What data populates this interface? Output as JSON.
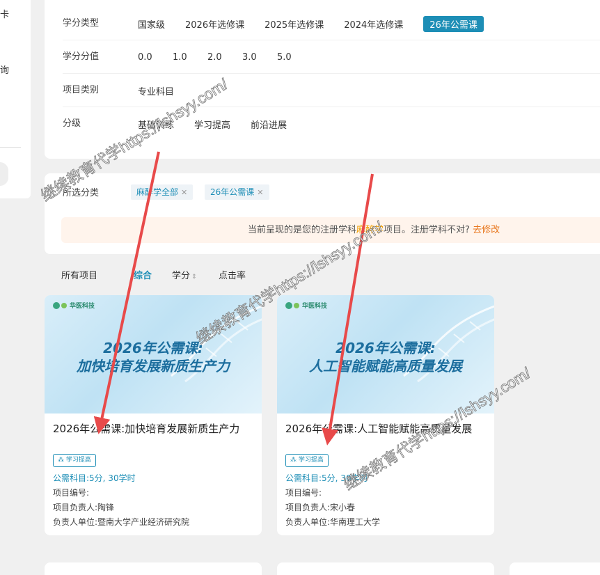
{
  "sidebar": {
    "frag_top": "卡",
    "frag_mid": "询"
  },
  "filters": {
    "credit_type": {
      "label": "学分类型",
      "options": [
        "国家级",
        "2026年选修课",
        "2025年选修课",
        "2024年选修课",
        "26年公需课"
      ],
      "active": "26年公需课"
    },
    "credit_value": {
      "label": "学分分值",
      "options": [
        "0.0",
        "1.0",
        "2.0",
        "3.0",
        "5.0"
      ]
    },
    "category": {
      "label": "项目类别",
      "options": [
        "专业科目"
      ]
    },
    "level": {
      "label": "分级",
      "options": [
        "基础训练",
        "学习提高",
        "前沿进展"
      ]
    }
  },
  "selected": {
    "label": "所选分类",
    "tags": [
      "麻醉学全部",
      "26年公需课"
    ],
    "notice_pre": "当前呈现的是您的注册学科",
    "notice_subject": "麻醉学",
    "notice_mid": "项目。注册学科不对?",
    "notice_link": "去修改"
  },
  "sort": {
    "all": "所有项目",
    "overall": "综合",
    "credit": "学分",
    "clicks": "点击率",
    "sort_icon": "⇕"
  },
  "cards": [
    {
      "logo": "华医科技",
      "cover_line1": "2026年公需课:",
      "cover_line2": "加快培育发展新质生产力",
      "title": "2026年公需课:加快培育发展新质生产力",
      "badge": "学习提高",
      "credit": "公需科目:5分, 30学时",
      "code_label": "项目编号:",
      "leader": "项目负责人:陶锋",
      "unit": "负责人单位:暨南大学产业经济研究院"
    },
    {
      "logo": "华医科技",
      "cover_line1": "2026年公需课:",
      "cover_line2": "人工智能赋能高质量发展",
      "title": "2026年公需课:人工智能赋能高质量发展",
      "badge": "学习提高",
      "credit": "公需科目:5分, 30学时",
      "code_label": "项目编号:",
      "leader": "项目负责人:宋小春",
      "unit": "负责人单位:华南理工大学"
    }
  ],
  "watermarks": [
    "继续教育代学https://lshsyy.com/",
    "继续教育代学https://lshsyy.com/",
    "继续教育代学https://lshsyy.com/"
  ],
  "colors": {
    "accent": "#1d8eb6",
    "arrow": "#e84a4a",
    "notice_bg": "#fff4ec",
    "link": "#e8761c"
  }
}
